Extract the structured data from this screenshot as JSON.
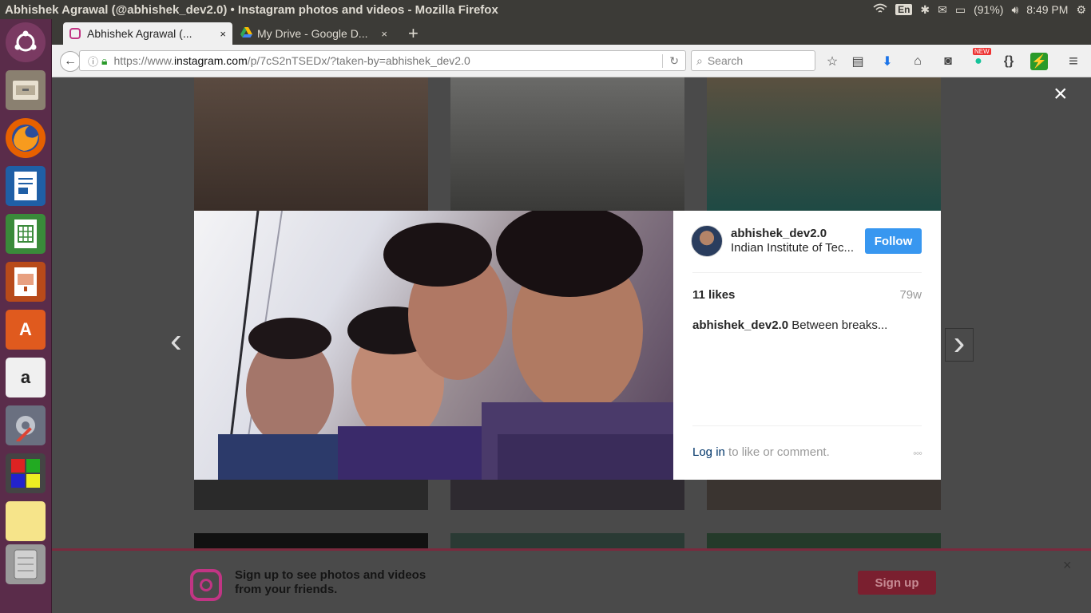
{
  "window": {
    "title": "Abhishek Agrawal (@abhishek_dev2.0) • Instagram photos and videos - Mozilla Firefox"
  },
  "system": {
    "keyboard": "En",
    "battery": "(91%)",
    "time": "8:49 PM"
  },
  "tabs": [
    {
      "label": "Abhishek Agrawal (...",
      "close": "×"
    },
    {
      "label": "My Drive - Google D...",
      "close": "×"
    }
  ],
  "newtab": "+",
  "urlbar": {
    "prefix": "https://www.",
    "host": "instagram.com",
    "path": "/p/7cS2nTSEDx/?taken-by=abhishek_dev2.0"
  },
  "search": {
    "placeholder": "Search"
  },
  "toolbar": {
    "badge": "NEW",
    "braces": "{}"
  },
  "post": {
    "username": "abhishek_dev2.0",
    "location": "Indian Institute of Tec...",
    "follow": "Follow",
    "likes": "11 likes",
    "age": "79w",
    "caption_user": "abhishek_dev2.0",
    "caption": "Between breaks...",
    "login": "Log in",
    "login_rest": "to like or comment.",
    "more": "◦◦◦"
  },
  "modal": {
    "close": "×",
    "prev": "‹",
    "next": "›"
  },
  "signup": {
    "line1": "Sign up to see photos and videos",
    "line2": "from your friends.",
    "button": "Sign up",
    "close": "×"
  },
  "colors": {
    "follow": "#3897f0",
    "launcher": "#5a2c4a",
    "signup_button": "#7a1f2f"
  }
}
